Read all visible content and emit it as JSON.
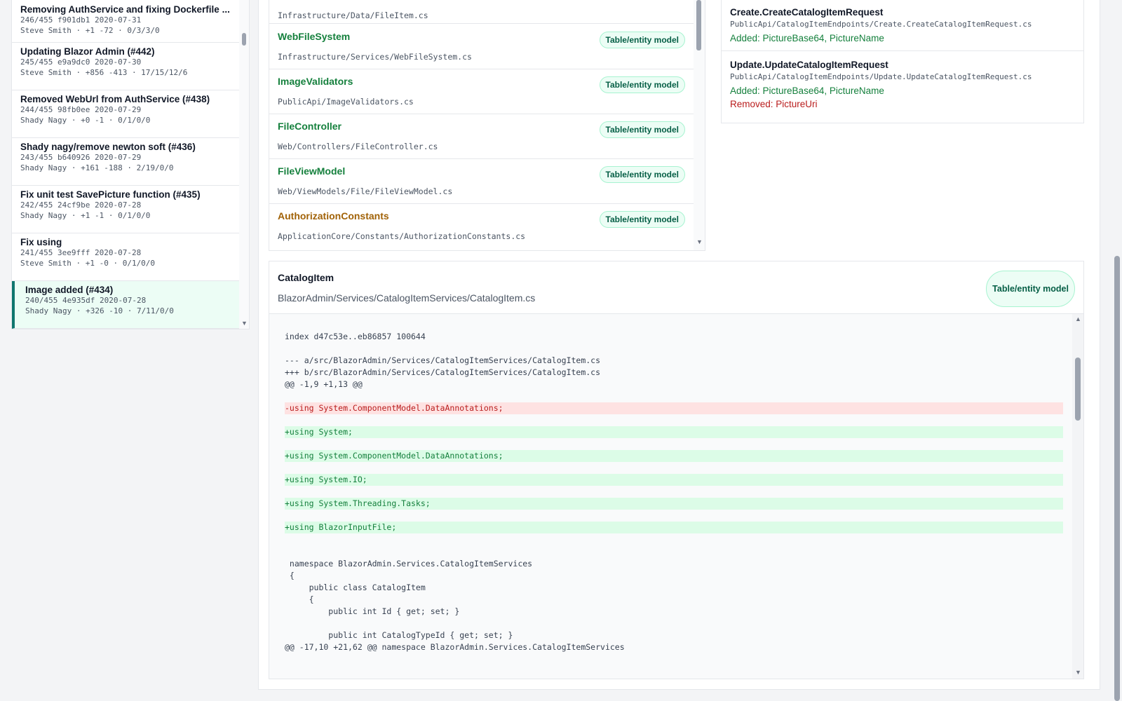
{
  "commits": [
    {
      "title": "Removing AuthService and fixing Dockerfile ...",
      "meta1": "246/455 f901db1 2020-07-31",
      "meta2": "Steve Smith · +1 -72 · 0/3/3/0"
    },
    {
      "title": "Updating Blazor Admin (#442)",
      "meta1": "245/455 e9a9dc0 2020-07-30",
      "meta2": "Steve Smith · +856 -413 · 17/15/12/6"
    },
    {
      "title": "Removed WebUrl from AuthService (#438)",
      "meta1": "244/455 98fb0ee 2020-07-29",
      "meta2": "Shady Nagy · +0 -1 · 0/1/0/0"
    },
    {
      "title": "Shady nagy/remove newton soft (#436)",
      "meta1": "243/455 b640926 2020-07-29",
      "meta2": "Shady Nagy · +161 -188 · 2/19/0/0"
    },
    {
      "title": "Fix unit test SavePicture function (#435)",
      "meta1": "242/455 24cf9be 2020-07-28",
      "meta2": "Shady Nagy · +1 -1 · 0/1/0/0"
    },
    {
      "title": "Fix using",
      "meta1": "241/455 3ee9fff 2020-07-28",
      "meta2": "Steve Smith · +1 -0 · 0/1/0/0"
    },
    {
      "title": "Image added (#434)",
      "meta1": "240/455 4e935df 2020-07-28",
      "meta2": "Shady Nagy · +326 -10 · 7/11/0/0"
    }
  ],
  "files": {
    "partial_path": "Infrastructure/Data/FileItem.cs",
    "items": [
      {
        "name": "WebFileSystem",
        "path": "Infrastructure/Services/WebFileSystem.cs",
        "badge": "Table/entity model"
      },
      {
        "name": "ImageValidators",
        "path": "PublicApi/ImageValidators.cs",
        "badge": "Table/entity model"
      },
      {
        "name": "FileController",
        "path": "Web/Controllers/FileController.cs",
        "badge": "Table/entity model"
      },
      {
        "name": "FileViewModel",
        "path": "Web/ViewModels/File/FileViewModel.cs",
        "badge": "Table/entity model"
      },
      {
        "name": "AuthorizationConstants",
        "path": "ApplicationCore/Constants/AuthorizationConstants.cs",
        "badge": "Table/entity model"
      }
    ]
  },
  "summary": [
    {
      "title": "Create.CreateCatalogItemRequest",
      "path": "PublicApi/CatalogItemEndpoints/Create.CreateCatalogItemRequest.cs",
      "added": "Added: PictureBase64, PictureName",
      "removed": ""
    },
    {
      "title": "Update.UpdateCatalogItemRequest",
      "path": "PublicApi/CatalogItemEndpoints/Update.UpdateCatalogItemRequest.cs",
      "added": "Added: PictureBase64, PictureName",
      "removed": "Removed: PictureUri"
    }
  ],
  "diff": {
    "title": "CatalogItem",
    "path": "BlazorAdmin/Services/CatalogItemServices/CatalogItem.cs",
    "badge": "Table/entity model",
    "lines": [
      {
        "text": "index d47c53e..eb86857 100644",
        "type": "ctx"
      },
      {
        "text": "--- a/src/BlazorAdmin/Services/CatalogItemServices/CatalogItem.cs",
        "type": "ctx"
      },
      {
        "text": "+++ b/src/BlazorAdmin/Services/CatalogItemServices/CatalogItem.cs",
        "type": "ctx"
      },
      {
        "text": "@@ -1,9 +1,13 @@",
        "type": "ctx"
      },
      {
        "text": "-using System.ComponentModel.DataAnnotations;",
        "type": "del"
      },
      {
        "text": "+using System;",
        "type": "add"
      },
      {
        "text": "+using System.ComponentModel.DataAnnotations;",
        "type": "add"
      },
      {
        "text": "+using System.IO;",
        "type": "add"
      },
      {
        "text": "+using System.Threading.Tasks;",
        "type": "add"
      },
      {
        "text": "+using BlazorInputFile;",
        "type": "add"
      },
      {
        "text": " namespace BlazorAdmin.Services.CatalogItemServices",
        "type": "ctx"
      },
      {
        "text": " {",
        "type": "ctx"
      },
      {
        "text": "     public class CatalogItem",
        "type": "ctx"
      },
      {
        "text": "     {",
        "type": "ctx"
      },
      {
        "text": "         public int Id { get; set; }",
        "type": "ctx"
      },
      {
        "text": "         public int CatalogTypeId { get; set; }",
        "type": "ctx"
      },
      {
        "text": "@@ -17,10 +21,62 @@ namespace BlazorAdmin.Services.CatalogItemServices",
        "type": "ctx"
      }
    ]
  }
}
